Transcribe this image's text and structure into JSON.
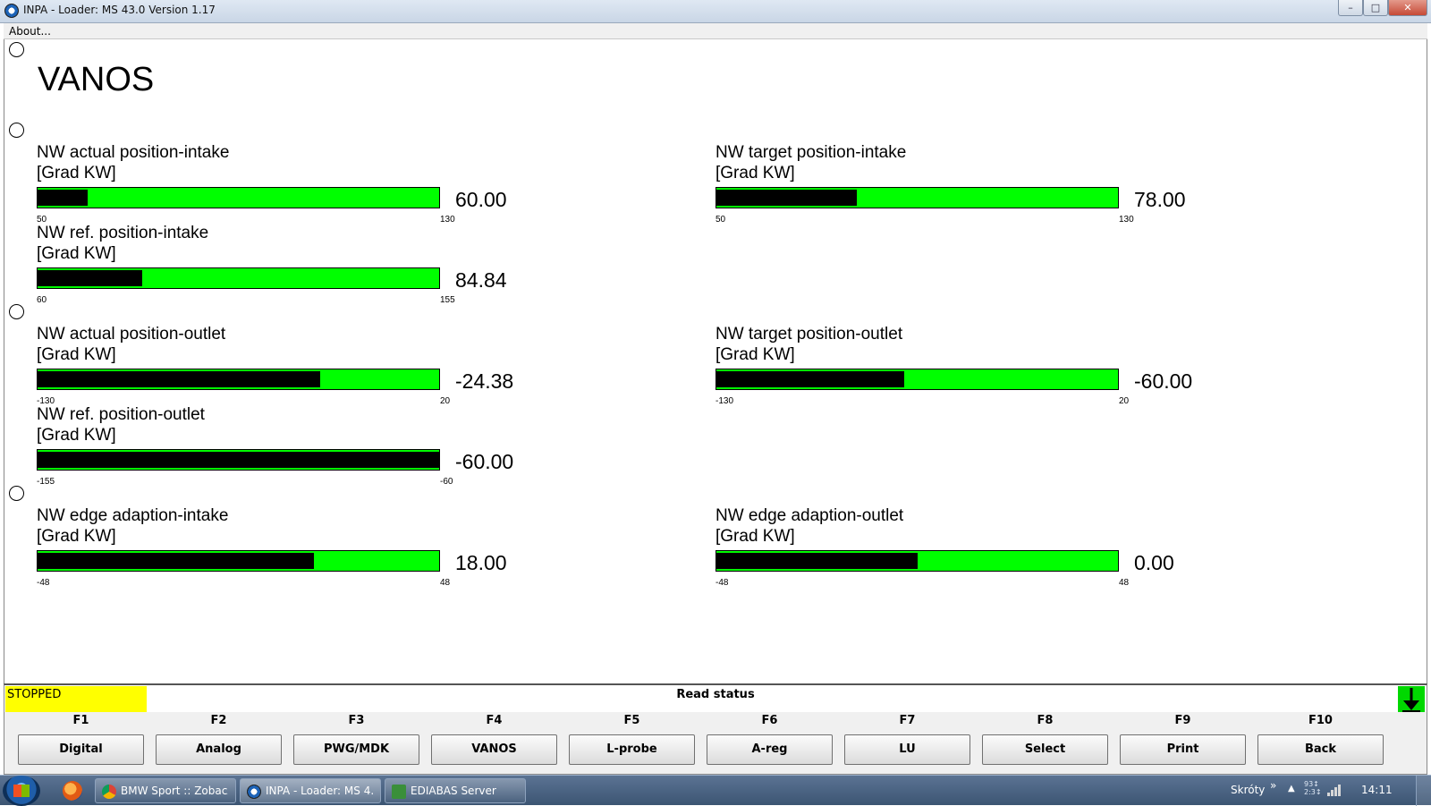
{
  "window": {
    "title": "INPA - Loader:  MS 43.0 Version 1.17",
    "minimize_glyph": "–",
    "maximize_glyph": "□",
    "close_glyph": "✕"
  },
  "menu": {
    "about": "About..."
  },
  "screen": {
    "heading": "VANOS",
    "gauges": [
      {
        "id": "nw-actual-position-intake",
        "name": "NW actual position-intake",
        "unit": "[Grad KW]",
        "value_text": "60.00",
        "value": 60.0,
        "min": 50,
        "max": 130,
        "min_label": "50",
        "max_label": "130"
      },
      {
        "id": "nw-target-position-intake",
        "name": "NW target position-intake",
        "unit": "[Grad KW]",
        "value_text": "78.00",
        "value": 78.0,
        "min": 50,
        "max": 130,
        "min_label": "50",
        "max_label": "130"
      },
      {
        "id": "nw-ref-position-intake",
        "name": "NW ref. position-intake",
        "unit": "[Grad KW]",
        "value_text": "84.84",
        "value": 84.84,
        "min": 60,
        "max": 155,
        "min_label": "60",
        "max_label": "155"
      },
      {
        "id": "nw-actual-position-outlet",
        "name": "NW actual position-outlet",
        "unit": "[Grad KW]",
        "value_text": "-24.38",
        "value": -24.38,
        "min": -130,
        "max": 20,
        "min_label": "-130",
        "max_label": "20"
      },
      {
        "id": "nw-target-position-outlet",
        "name": "NW target position-outlet",
        "unit": "[Grad KW]",
        "value_text": "-60.00",
        "value": -60.0,
        "min": -130,
        "max": 20,
        "min_label": "-130",
        "max_label": "20"
      },
      {
        "id": "nw-ref-position-outlet",
        "name": "NW ref. position-outlet",
        "unit": "[Grad KW]",
        "value_text": "-60.00",
        "value": -60.0,
        "min": -155,
        "max": -60,
        "min_label": "-155",
        "max_label": "-60"
      },
      {
        "id": "nw-edge-adaption-intake",
        "name": "NW edge adaption-intake",
        "unit": "[Grad KW]",
        "value_text": "18.00",
        "value": 18.0,
        "min": -48,
        "max": 48,
        "min_label": "-48",
        "max_label": "48"
      },
      {
        "id": "nw-edge-adaption-outlet",
        "name": "NW edge adaption-outlet",
        "unit": "[Grad KW]",
        "value_text": "0.00",
        "value": 0.0,
        "min": -48,
        "max": 48,
        "min_label": "-48",
        "max_label": "48"
      }
    ]
  },
  "status": {
    "state": "STOPPED",
    "message": "Read status",
    "state_color": "#ffff00",
    "bar_color": "#00ff00",
    "fill_color": "#000000"
  },
  "fkeys": [
    {
      "key": "F1",
      "label": "Digital"
    },
    {
      "key": "F2",
      "label": "Analog"
    },
    {
      "key": "F3",
      "label": "PWG/MDK"
    },
    {
      "key": "F4",
      "label": "VANOS"
    },
    {
      "key": "F5",
      "label": "L-probe"
    },
    {
      "key": "F6",
      "label": "A-reg"
    },
    {
      "key": "F7",
      "label": "LU"
    },
    {
      "key": "F8",
      "label": "Select"
    },
    {
      "key": "F9",
      "label": "Print"
    },
    {
      "key": "F10",
      "label": "Back"
    }
  ],
  "taskbar": {
    "tasks": [
      {
        "label": "BMW Sport :: Zobacz..."
      },
      {
        "label": "INPA - Loader:  MS 4..."
      },
      {
        "label": "EDIABAS Server"
      }
    ],
    "toolbar_label": "Skróty",
    "chevron": "»",
    "tray_up": "▲",
    "speed_top": "93↕",
    "speed_bottom": "2:3↕",
    "clock": "14:11"
  }
}
